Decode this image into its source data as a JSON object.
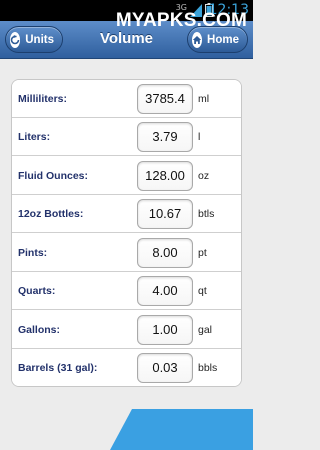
{
  "status": {
    "network": "3G",
    "time": "12:13"
  },
  "titlebar": {
    "title": "Volume",
    "back_label": "Units",
    "home_label": "Home"
  },
  "rows": [
    {
      "label": "Milliliters:",
      "value": "3785.4",
      "unit": "ml"
    },
    {
      "label": "Liters:",
      "value": "3.79",
      "unit": "l"
    },
    {
      "label": "Fluid Ounces:",
      "value": "128.00",
      "unit": "oz"
    },
    {
      "label": "12oz Bottles:",
      "value": "10.67",
      "unit": "btls"
    },
    {
      "label": "Pints:",
      "value": "8.00",
      "unit": "pt"
    },
    {
      "label": "Quarts:",
      "value": "4.00",
      "unit": "qt"
    },
    {
      "label": "Gallons:",
      "value": "1.00",
      "unit": "gal"
    },
    {
      "label": "Barrels (31 gal):",
      "value": "0.03",
      "unit": "bbls"
    }
  ],
  "watermark": "MYAPKS.COM",
  "colors": {
    "titlebar": "#3b6aab",
    "label": "#23326b",
    "watermark": "#3aa0e2"
  }
}
